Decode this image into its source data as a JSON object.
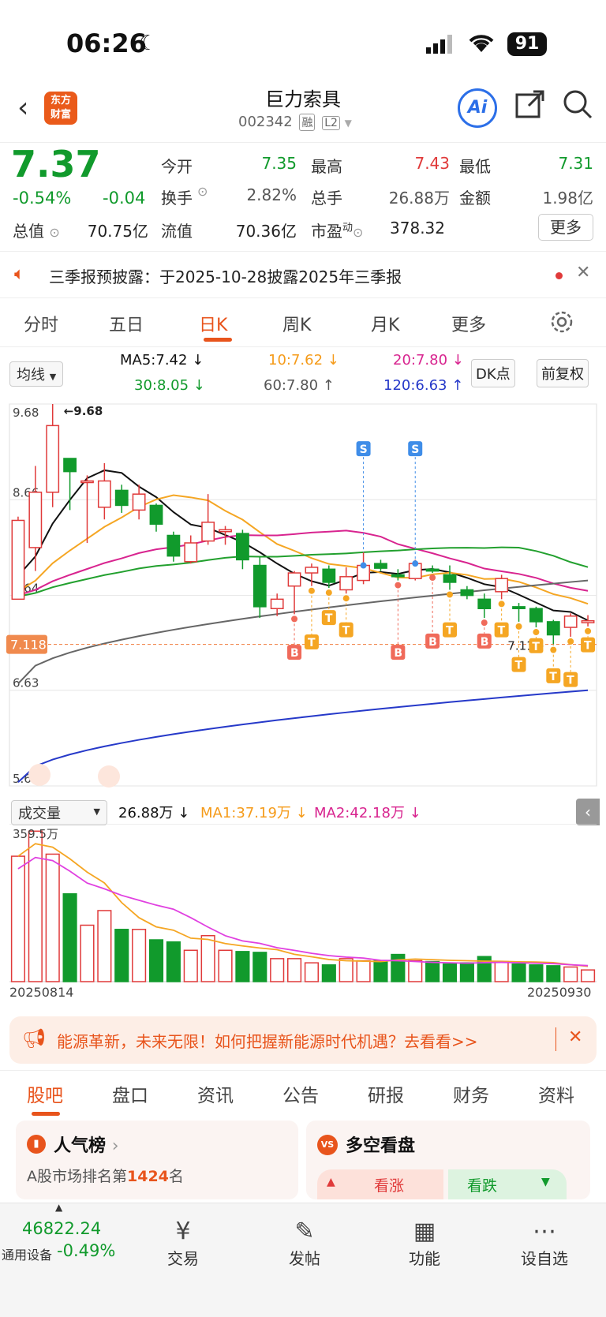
{
  "status": {
    "time": "06:26",
    "battery": "91"
  },
  "header": {
    "title": "巨力索具",
    "code": "002342",
    "tag1": "融",
    "tag2": "L2",
    "logo_line1": "东方",
    "logo_line2": "财富",
    "ai_label": "Ai"
  },
  "quote": {
    "price": "7.37",
    "pct": "-0.54%",
    "chg": "-0.04",
    "rows": [
      [
        {
          "l": "今开",
          "v": "7.35",
          "c": "green"
        },
        {
          "l": "最高",
          "v": "7.43",
          "c": "red"
        },
        {
          "l": "最低",
          "v": "7.31",
          "c": "green"
        }
      ],
      [
        {
          "l": "换手",
          "v": "2.82%",
          "c": "grey"
        },
        {
          "l": "总手",
          "v": "26.88万",
          "c": "grey"
        },
        {
          "l": "金额",
          "v": "1.98亿",
          "c": "grey"
        }
      ]
    ],
    "total_label": "总值",
    "total_value": "70.75亿",
    "float_label": "流值",
    "float_value": "70.36亿",
    "pe_label": "市盈",
    "pe_sup": "动",
    "pe_value": "378.32",
    "more_btn": "更多"
  },
  "notice": {
    "text": "三季报预披露：于2025-10-28披露2025年三季报"
  },
  "tabs": [
    {
      "label": "分时",
      "active": false
    },
    {
      "label": "五日",
      "active": false
    },
    {
      "label": "日K",
      "active": true
    },
    {
      "label": "周K",
      "active": false
    },
    {
      "label": "月K",
      "active": false
    },
    {
      "label": "更多",
      "active": false
    }
  ],
  "indicators": {
    "select": "均线",
    "ma5": "MA5:7.42 ↓",
    "ma10": "10:7.62 ↓",
    "ma20": "20:7.80 ↓",
    "ma30": "30:8.05 ↓",
    "ma60": "60:7.80 ↑",
    "ma120": "120:6.63 ↑",
    "dk_btn": "DK点",
    "adjust_btn": "前复权"
  },
  "colors": {
    "up": "#e03a3a",
    "down": "#119a2c",
    "ma5": "#111111",
    "ma10": "#f5a623",
    "ma20": "#d8248f",
    "ma30": "#22a02e",
    "ma60": "#666666",
    "ma120": "#2639c9",
    "accent": "#e8541c"
  },
  "chart_data": {
    "type": "candlestick",
    "y_ticks": [
      "9.68",
      "8.66",
      "7.64",
      "6.63",
      "5.61"
    ],
    "ylim": [
      5.61,
      9.68
    ],
    "high_label": "←9.68",
    "low_label": "7.11→",
    "current_line_label": "7.118",
    "candles": [
      {
        "o": 7.6,
        "c": 8.44,
        "h": 8.48,
        "l": 7.6
      },
      {
        "o": 8.15,
        "c": 8.74,
        "h": 9.02,
        "l": 7.9
      },
      {
        "o": 8.74,
        "c": 9.45,
        "h": 9.68,
        "l": 8.58
      },
      {
        "o": 9.1,
        "c": 8.96,
        "h": 9.1,
        "l": 8.55
      },
      {
        "o": 8.86,
        "c": 8.86,
        "h": 8.92,
        "l": 8.2
      },
      {
        "o": 8.58,
        "c": 8.86,
        "h": 9.05,
        "l": 8.45
      },
      {
        "o": 8.76,
        "c": 8.6,
        "h": 8.82,
        "l": 8.52
      },
      {
        "o": 8.55,
        "c": 8.72,
        "h": 8.82,
        "l": 8.45
      },
      {
        "o": 8.6,
        "c": 8.4,
        "h": 8.62,
        "l": 8.32
      },
      {
        "o": 8.28,
        "c": 8.06,
        "h": 8.32,
        "l": 8.0
      },
      {
        "o": 8.0,
        "c": 8.2,
        "h": 8.28,
        "l": 7.98
      },
      {
        "o": 8.22,
        "c": 8.42,
        "h": 8.72,
        "l": 8.18
      },
      {
        "o": 8.32,
        "c": 8.34,
        "h": 8.38,
        "l": 8.18
      },
      {
        "o": 8.3,
        "c": 8.02,
        "h": 8.34,
        "l": 7.92
      },
      {
        "o": 7.96,
        "c": 7.52,
        "h": 8.05,
        "l": 7.4
      },
      {
        "o": 7.5,
        "c": 7.6,
        "h": 7.66,
        "l": 7.42
      },
      {
        "o": 7.74,
        "c": 7.88,
        "h": 7.9,
        "l": 7.44
      },
      {
        "o": 7.88,
        "c": 7.94,
        "h": 7.98,
        "l": 7.74
      },
      {
        "o": 7.92,
        "c": 7.78,
        "h": 7.96,
        "l": 7.72
      },
      {
        "o": 7.7,
        "c": 7.84,
        "h": 7.94,
        "l": 7.66
      },
      {
        "o": 7.8,
        "c": 7.96,
        "h": 8.1,
        "l": 7.76
      },
      {
        "o": 7.98,
        "c": 7.93,
        "h": 8.02,
        "l": 7.9
      },
      {
        "o": 7.86,
        "c": 7.84,
        "h": 7.92,
        "l": 7.8
      },
      {
        "o": 7.82,
        "c": 7.98,
        "h": 8.02,
        "l": 7.8
      },
      {
        "o": 7.92,
        "c": 7.9,
        "h": 7.96,
        "l": 7.88
      },
      {
        "o": 7.86,
        "c": 7.78,
        "h": 7.96,
        "l": 7.7
      },
      {
        "o": 7.7,
        "c": 7.64,
        "h": 7.74,
        "l": 7.6
      },
      {
        "o": 7.6,
        "c": 7.5,
        "h": 7.66,
        "l": 7.4
      },
      {
        "o": 7.68,
        "c": 7.82,
        "h": 7.86,
        "l": 7.6
      },
      {
        "o": 7.52,
        "c": 7.5,
        "h": 7.56,
        "l": 7.36
      },
      {
        "o": 7.5,
        "c": 7.36,
        "h": 7.52,
        "l": 7.3
      },
      {
        "o": 7.36,
        "c": 7.22,
        "h": 7.38,
        "l": 7.11
      },
      {
        "o": 7.3,
        "c": 7.42,
        "h": 7.45,
        "l": 7.2
      },
      {
        "o": 7.35,
        "c": 7.37,
        "h": 7.43,
        "l": 7.31
      }
    ],
    "signals": [
      {
        "i": 16,
        "t": "B"
      },
      {
        "i": 17,
        "t": "T"
      },
      {
        "i": 18,
        "t": "T"
      },
      {
        "i": 19,
        "t": "T"
      },
      {
        "i": 20,
        "t": "S"
      },
      {
        "i": 22,
        "t": "B"
      },
      {
        "i": 23,
        "t": "S"
      },
      {
        "i": 24,
        "t": "B"
      },
      {
        "i": 25,
        "t": "T"
      },
      {
        "i": 27,
        "t": "B"
      },
      {
        "i": 28,
        "t": "T"
      },
      {
        "i": 29,
        "t": "T"
      },
      {
        "i": 30,
        "t": "T"
      },
      {
        "i": 31,
        "t": "T"
      },
      {
        "i": 32,
        "t": "T"
      },
      {
        "i": 33,
        "t": "T"
      }
    ],
    "x_start": "20250814",
    "x_end": "20250930",
    "volume": {
      "select": "成交量",
      "current": "26.88万 ↓",
      "ma1": "MA1:37.19万 ↓",
      "ma2": "MA2:42.18万 ↓",
      "max_label": "359.5万",
      "values": [
        300,
        360,
        305,
        210,
        135,
        170,
        125,
        125,
        100,
        95,
        75,
        110,
        75,
        72,
        70,
        55,
        55,
        45,
        40,
        55,
        50,
        50,
        65,
        50,
        48,
        42,
        45,
        60,
        48,
        42,
        40,
        38,
        35,
        28
      ]
    }
  },
  "banner": {
    "text": "能源革新，未来无限！如何把握新能源时代机遇？去看看>>"
  },
  "bottom_tabs": [
    {
      "label": "股吧",
      "active": true
    },
    {
      "label": "盘口",
      "active": false
    },
    {
      "label": "资讯",
      "active": false
    },
    {
      "label": "公告",
      "active": false
    },
    {
      "label": "研报",
      "active": false
    },
    {
      "label": "财务",
      "active": false
    },
    {
      "label": "资料",
      "active": false
    }
  ],
  "cards": {
    "popularity_title": "人气榜",
    "rank_text_prefix": "A股市场排名第",
    "rank_num": "1424",
    "rank_suffix": "名",
    "longshort_title": "多空看盘",
    "bull": "看涨",
    "bear": "看跌"
  },
  "bottom_nav": {
    "index_value": "46822.24",
    "index_name": "通用设备",
    "index_pct": "-0.49%",
    "items": [
      {
        "label": "交易",
        "icon": "¥"
      },
      {
        "label": "发帖",
        "icon": "✎"
      },
      {
        "label": "功能",
        "icon": "▦"
      },
      {
        "label": "设自选",
        "icon": "⋯"
      }
    ]
  }
}
